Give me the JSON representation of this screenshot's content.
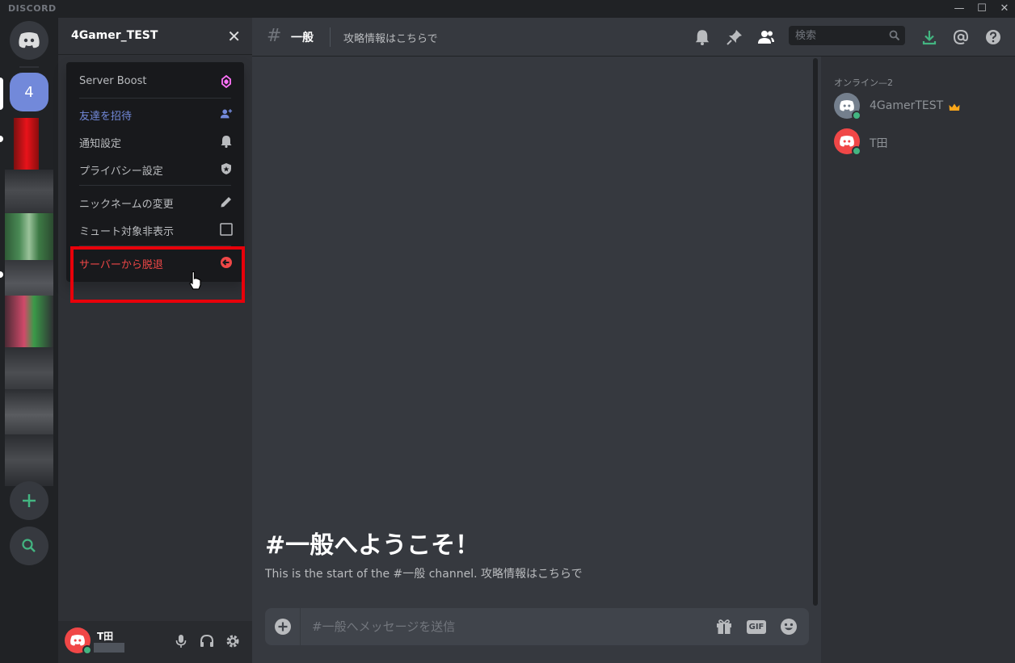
{
  "app": {
    "brand": "DISCORD"
  },
  "window_controls": {
    "minimize": "—",
    "maximize": "☐",
    "close": "✕"
  },
  "servers": {
    "active_label": "4"
  },
  "guild": {
    "name": "4Gamer_TEST",
    "close": "✕"
  },
  "menu": {
    "items": [
      {
        "label": "Server Boost",
        "icon": "boost-icon"
      },
      {
        "label": "友達を招待",
        "icon": "add-user-icon"
      },
      {
        "label": "通知設定",
        "icon": "bell-icon"
      },
      {
        "label": "プライバシー設定",
        "icon": "shield-icon"
      },
      {
        "label": "ニックネームの変更",
        "icon": "pencil-icon"
      },
      {
        "label": "ミュート対象非表示",
        "icon": "checkbox-icon"
      },
      {
        "label": "サーバーから脱退",
        "icon": "leave-icon"
      }
    ]
  },
  "channel": {
    "hash": "#",
    "name": "一般",
    "topic": "攻略情報はこちらで"
  },
  "search": {
    "placeholder": "検索"
  },
  "welcome": {
    "title": "#一般へようこそ！",
    "subtitle": "This is the start of the #一般 channel. 攻略情報はこちらで"
  },
  "composer": {
    "placeholder": "#一般へメッセージを送信",
    "gif": "GIF"
  },
  "members": {
    "header": "オンライン—2",
    "list": [
      {
        "name": "4GamerTEST",
        "avatar_color": "#747f8d",
        "owner": true
      },
      {
        "name": "T田",
        "avatar_color": "#f04747",
        "owner": false
      }
    ]
  },
  "user": {
    "name": "T田"
  },
  "colors": {
    "accent": "#7289da",
    "danger": "#f04747",
    "online": "#43b581",
    "highlight": "#e8000a"
  }
}
